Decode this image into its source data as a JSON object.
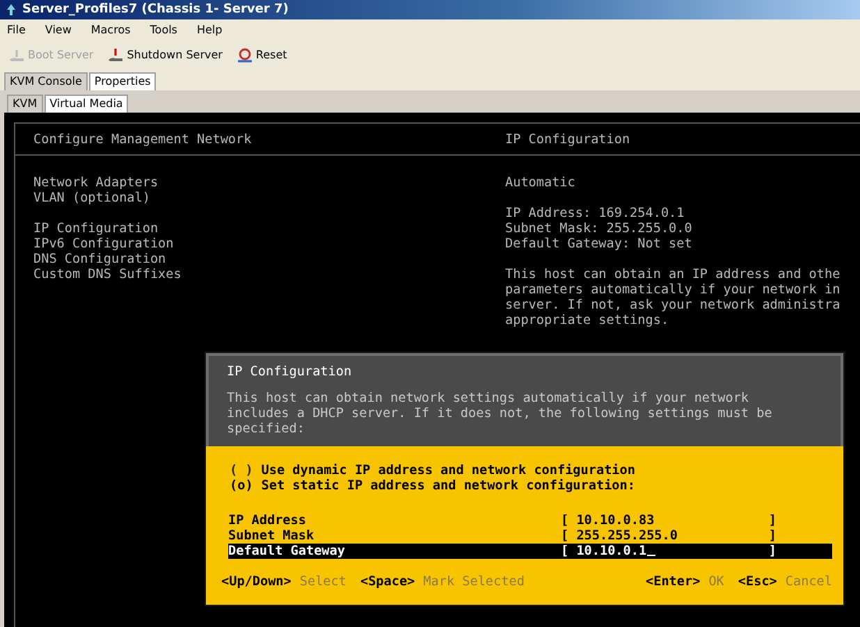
{
  "window": {
    "title": "Server_Profiles7 (Chassis 1- Server 7)"
  },
  "menu": [
    "File",
    "View",
    "Macros",
    "Tools",
    "Help"
  ],
  "toolbar": [
    {
      "label": "Boot Server",
      "kind": "boot",
      "disabled": true
    },
    {
      "label": "Shutdown Server",
      "kind": "shutdown",
      "disabled": false
    },
    {
      "label": "Reset",
      "kind": "reset",
      "disabled": false
    }
  ],
  "tabs": [
    {
      "label": "KVM Console",
      "selected": true
    },
    {
      "label": "Properties",
      "selected": false
    }
  ],
  "subtabs": [
    {
      "label": "KVM",
      "selected": true
    },
    {
      "label": "Virtual Media",
      "selected": false
    }
  ],
  "console": {
    "left_title": "Configure Management Network",
    "right_title": "IP Configuration",
    "menu_groups": [
      [
        "Network Adapters",
        "VLAN (optional)"
      ],
      [
        "IP Configuration",
        "IPv6 Configuration",
        "DNS Configuration",
        "Custom DNS Suffixes"
      ]
    ],
    "mode": "Automatic",
    "details": [
      "IP Address: 169.254.0.1",
      "Subnet Mask: 255.255.0.0",
      "Default Gateway: Not set"
    ],
    "description": [
      "This host can obtain an IP address and othe",
      "parameters automatically if your network in",
      "server. If not, ask your network administra",
      "appropriate settings."
    ]
  },
  "dialog": {
    "title": "IP Configuration",
    "text": [
      "This host can obtain network settings automatically if your network",
      "includes a DHCP server. If it does not, the following settings must be",
      "specified:"
    ],
    "radio_brackets": [
      "(",
      ")"
    ],
    "radio_mark": "o",
    "options": [
      {
        "label": "Use dynamic IP address and network configuration",
        "selected": false
      },
      {
        "label": "Set static IP address and network configuration:",
        "selected": true
      }
    ],
    "bracket_open": "[",
    "bracket_close": "]",
    "fields": [
      {
        "label": "IP Address",
        "value": "10.10.0.83",
        "selected": false
      },
      {
        "label": "Subnet Mask",
        "value": "255.255.255.0",
        "selected": false
      },
      {
        "label": "Default Gateway",
        "value": "10.10.0.1",
        "selected": true
      }
    ],
    "hints_left": [
      {
        "key": "<Up/Down>",
        "action": "Select"
      },
      {
        "key": "<Space>",
        "action": "Mark Selected"
      }
    ],
    "hints_right": [
      {
        "key": "<Enter>",
        "action": "OK"
      },
      {
        "key": "<Esc>",
        "action": "Cancel"
      }
    ]
  }
}
